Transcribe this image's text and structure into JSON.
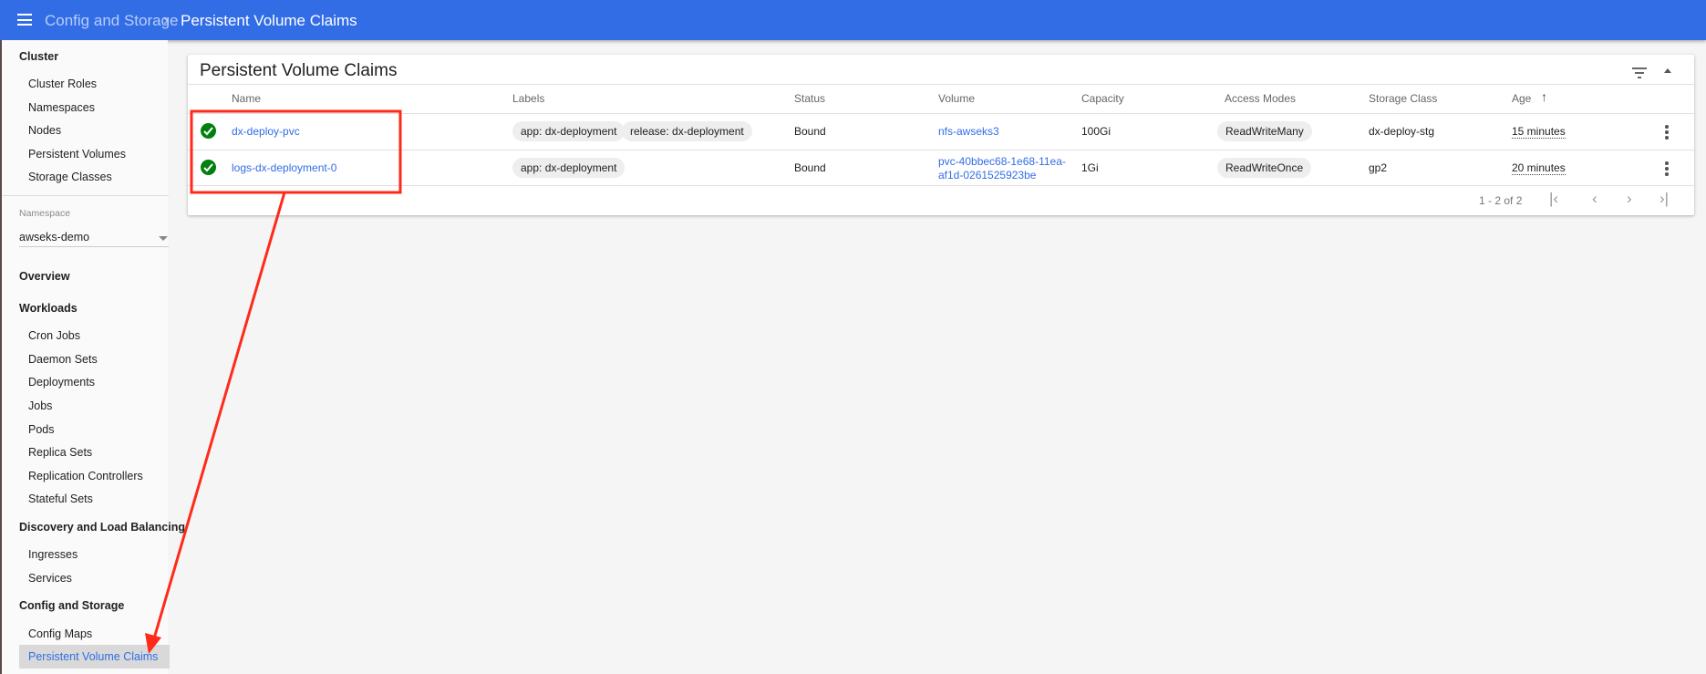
{
  "header": {
    "breadcrumb_parent": "Config and Storage",
    "breadcrumb_current": "Persistent Volume Claims"
  },
  "sidebar": {
    "cluster_heading": "Cluster",
    "cluster_items": [
      "Cluster Roles",
      "Namespaces",
      "Nodes",
      "Persistent Volumes",
      "Storage Classes"
    ],
    "namespace_label": "Namespace",
    "namespace_value": "awseks-demo",
    "overview": "Overview",
    "workloads_heading": "Workloads",
    "workloads_items": [
      "Cron Jobs",
      "Daemon Sets",
      "Deployments",
      "Jobs",
      "Pods",
      "Replica Sets",
      "Replication Controllers",
      "Stateful Sets"
    ],
    "discovery_heading": "Discovery and Load Balancing",
    "discovery_items": [
      "Ingresses",
      "Services"
    ],
    "config_heading": "Config and Storage",
    "config_items": [
      "Config Maps",
      "Persistent Volume Claims"
    ]
  },
  "card": {
    "title": "Persistent Volume Claims",
    "columns": [
      "Name",
      "Labels",
      "Status",
      "Volume",
      "Capacity",
      "Access Modes",
      "Storage Class",
      "Age"
    ],
    "rows": [
      {
        "name": "dx-deploy-pvc",
        "labels": [
          "app: dx-deployment",
          "release: dx-deployment"
        ],
        "status": "Bound",
        "volume": "nfs-awseks3",
        "volume2": "",
        "capacity": "100Gi",
        "access": "ReadWriteMany",
        "storage_class": "dx-deploy-stg",
        "age": "15 minutes"
      },
      {
        "name": "logs-dx-deployment-0",
        "labels": [
          "app: dx-deployment"
        ],
        "status": "Bound",
        "volume": "pvc-40bbec68-1e68-11ea-",
        "volume2": "af1d-0261525923be",
        "capacity": "1Gi",
        "access": "ReadWriteOnce",
        "storage_class": "gp2",
        "age": "20 minutes"
      }
    ],
    "pagination": "1 - 2 of 2",
    "sort_icon": "arrow-up-icon"
  },
  "colors": {
    "header": "#326de6",
    "link": "#326de6",
    "ok": "#00800f",
    "annotation": "#ff2a1a"
  }
}
